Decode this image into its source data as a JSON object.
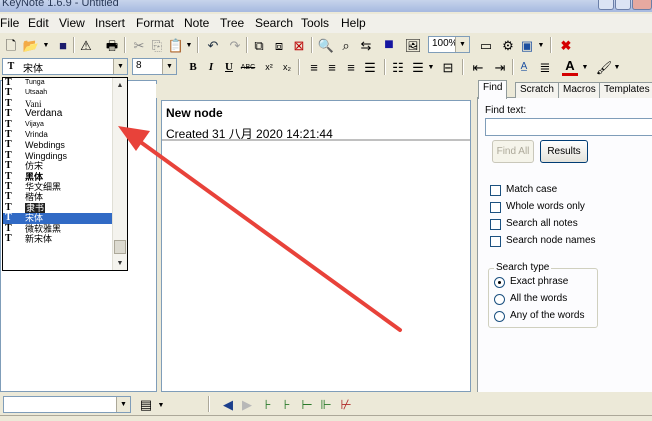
{
  "window": {
    "title": "KeyNote 1.6.9 - Untitled"
  },
  "menubar": {
    "items": [
      "File",
      "Edit",
      "View",
      "Insert",
      "Format",
      "Note",
      "Tree",
      "Search",
      "Tools",
      "Help"
    ]
  },
  "toolbar": {
    "zoom": "100%"
  },
  "format_bar": {
    "font_name": "宋体",
    "font_size": "8"
  },
  "font_list": {
    "items": [
      "Tunga",
      "Utsaah",
      "Vani",
      "Verdana",
      "Vijaya",
      "Vrinda",
      "Webdings",
      "Wingdings",
      "仿宋",
      "黑体",
      "华文细黑",
      "楷体",
      "隶书",
      "宋体",
      "微软雅黑",
      "新宋体"
    ],
    "selected": "宋体"
  },
  "note": {
    "title": "New node",
    "created": "Created 31 八月 2020 14:21:44"
  },
  "right_panel": {
    "tabs": [
      "Find",
      "Scratch",
      "Macros",
      "Templates"
    ],
    "active_tab": "Find",
    "find_label": "Find text:",
    "find_value": "",
    "find_all_label": "Find All",
    "results_label": "Results",
    "options": [
      "Match case",
      "Whole words only",
      "Search all notes",
      "Search node names"
    ],
    "search_type": {
      "title": "Search type",
      "options": [
        "Exact phrase",
        "All the words",
        "Any of the words"
      ],
      "selected": "Exact phrase"
    }
  },
  "colors": {
    "selection": "#316ac5",
    "arrow": "#e8423a",
    "font_color_bar": "#d40000"
  }
}
